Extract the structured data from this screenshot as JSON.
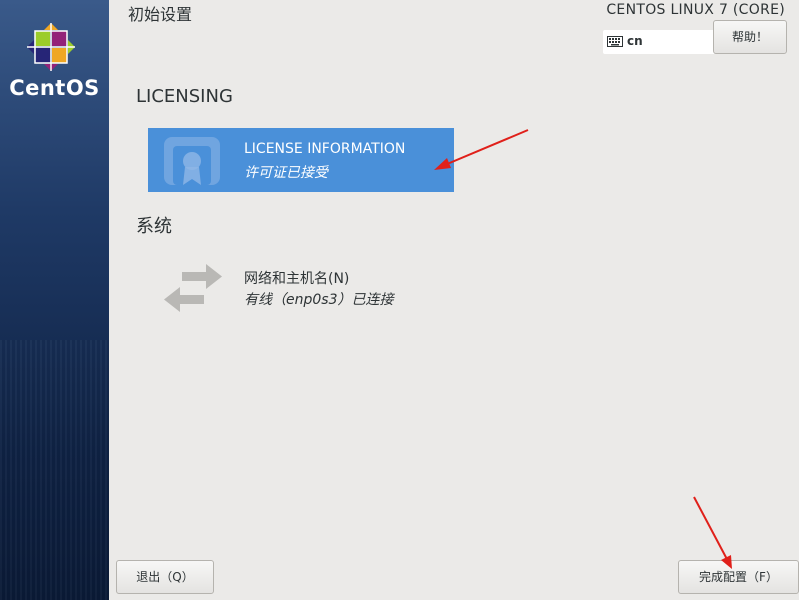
{
  "sidebar": {
    "logo_text": "CentOS"
  },
  "header": {
    "title": "初始设置",
    "os_name": "CENTOS LINUX 7 (CORE)",
    "keyboard_layout": "cn",
    "help_label": "帮助！"
  },
  "sections": [
    {
      "heading": "LICENSING",
      "spokes": [
        {
          "title": "LICENSE INFORMATION",
          "status": "许可证已接受",
          "icon": "license-icon",
          "selected": true
        }
      ]
    },
    {
      "heading": "系统",
      "spokes": [
        {
          "title": "网络和主机名(N)",
          "status": "有线（enp0s3）已连接",
          "icon": "network-icon",
          "selected": false
        }
      ]
    }
  ],
  "footer": {
    "quit_label": "退出（Q）",
    "finish_label": "完成配置（F）"
  },
  "colors": {
    "accent": "#4a90d9",
    "background": "#ebeae8",
    "sidebar": "#1f3a66",
    "annotation_arrow": "#e0201a"
  }
}
